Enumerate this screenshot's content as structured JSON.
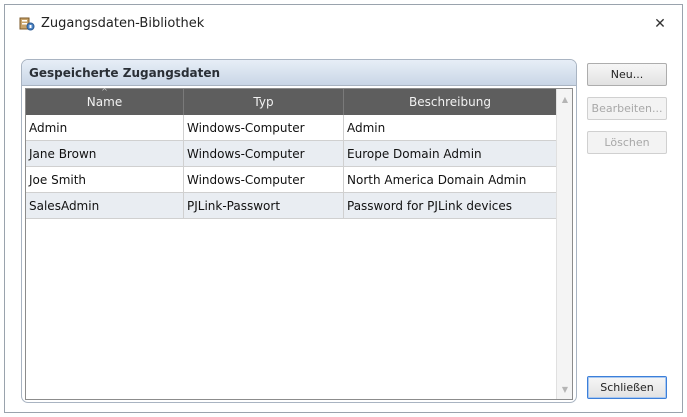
{
  "window": {
    "title": "Zugangsdaten-Bibliothek",
    "close_glyph": "✕"
  },
  "group": {
    "title": "Gespeicherte Zugangsdaten"
  },
  "table": {
    "columns": [
      "Name",
      "Typ",
      "Beschreibung"
    ],
    "sort_indicator": "^",
    "rows": [
      [
        "Admin",
        "Windows-Computer",
        "Admin"
      ],
      [
        "Jane Brown",
        "Windows-Computer",
        "Europe Domain Admin"
      ],
      [
        "Joe Smith",
        "Windows-Computer",
        "North America Domain Admin"
      ],
      [
        "SalesAdmin",
        "PJLink-Passwort",
        "Password for PJLink devices"
      ]
    ]
  },
  "buttons": {
    "new": "Neu...",
    "edit": "Bearbeiten...",
    "delete": "Löschen",
    "close": "Schließen"
  },
  "colors": {
    "header_bg": "#5e5e5e",
    "alt_row_bg": "#e9edf2",
    "group_header_bg": "#c9d6e6",
    "default_button_border": "#3c7fd9"
  }
}
